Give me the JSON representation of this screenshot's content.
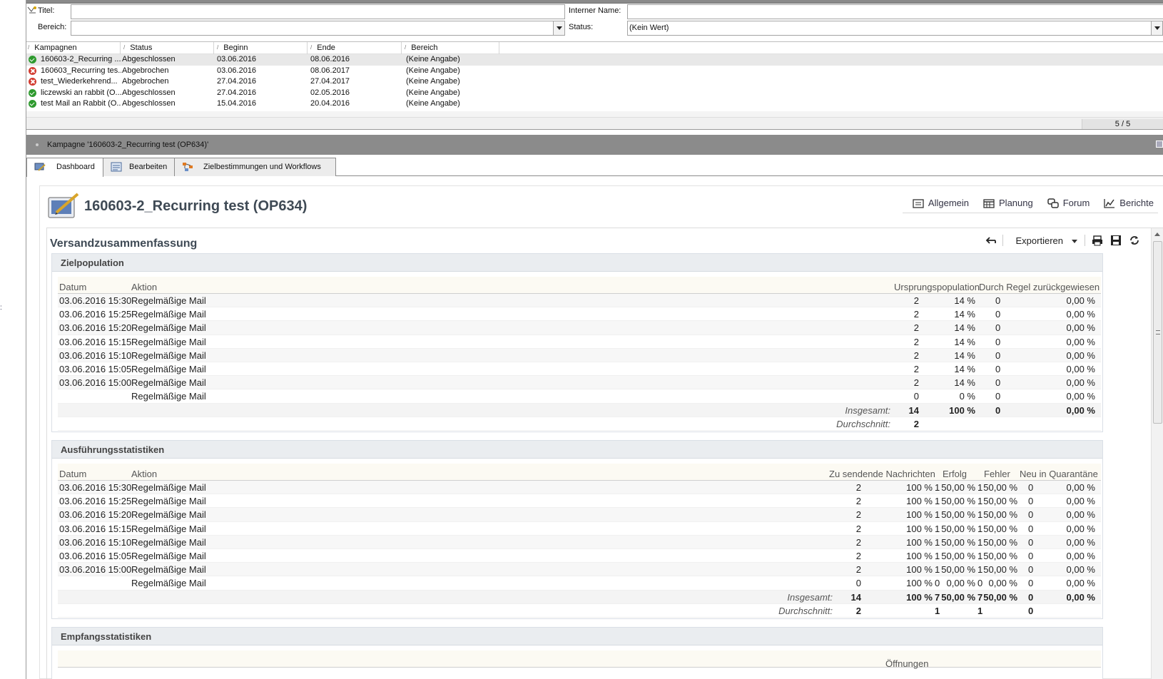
{
  "filter": {
    "title_label": "Titel:",
    "title_value": "",
    "internal_name_label": "Interner Name:",
    "internal_name_value": "",
    "area_label": "Bereich:",
    "area_value": "",
    "status_label": "Status:",
    "status_value": "(Kein Wert)"
  },
  "campaign_list": {
    "columns": [
      "Kampagnen",
      "Status",
      "Beginn",
      "Ende",
      "Bereich"
    ],
    "rows": [
      {
        "name": "160603-2_Recurring ...",
        "status": "Abgeschlossen",
        "begin": "03.06.2016",
        "end": "08.06.2016",
        "area": "(Keine Angabe)",
        "icon": "status-completed-icon"
      },
      {
        "name": "160603_Recurring tes...",
        "status": "Abgebrochen",
        "begin": "03.06.2016",
        "end": "08.06.2017",
        "area": "(Keine Angabe)",
        "icon": "status-cancelled-icon"
      },
      {
        "name": "test_Wiederkehrend...",
        "status": "Abgebrochen",
        "begin": "27.04.2016",
        "end": "27.04.2017",
        "area": "(Keine Angabe)",
        "icon": "status-cancelled-icon"
      },
      {
        "name": "liczewski an rabbit (O...",
        "status": "Abgeschlossen",
        "begin": "27.04.2016",
        "end": "02.05.2016",
        "area": "(Keine Angabe)",
        "icon": "status-completed-icon"
      },
      {
        "name": "test Mail an Rabbit (O...",
        "status": "Abgeschlossen",
        "begin": "15.04.2016",
        "end": "20.04.2016",
        "area": "(Keine Angabe)",
        "icon": "status-completed-icon"
      }
    ],
    "pager": "5 / 5"
  },
  "campaign_bar": {
    "title": "Kampagne '160603-2_Recurring test (OP634)'"
  },
  "tabs": [
    {
      "label": "Dashboard",
      "icon": "dashboard-icon",
      "active": true
    },
    {
      "label": "Bearbeiten",
      "icon": "edit-form-icon",
      "active": false
    },
    {
      "label": "Zielbestimmungen und Workflows",
      "icon": "workflow-icon",
      "active": false
    }
  ],
  "dashboard": {
    "title": "160603-2_Recurring test (OP634)",
    "nav": [
      {
        "label": "Allgemein",
        "icon": "general-icon"
      },
      {
        "label": "Planung",
        "icon": "calendar-icon"
      },
      {
        "label": "Forum",
        "icon": "forum-icon"
      },
      {
        "label": "Berichte",
        "icon": "chart-icon"
      }
    ]
  },
  "summary": {
    "title": "Versandzusammenfassung",
    "export_label": "Exportieren",
    "target": {
      "title": "Zielpopulation",
      "headers": [
        "Datum",
        "Aktion",
        "Ursprungspopulation",
        "Durch Regel zurückgewiesen"
      ],
      "rows": [
        [
          "03.06.2016 15:30",
          "Regelmäßige Mail",
          "2",
          "14 %",
          "0",
          "0,00 %"
        ],
        [
          "03.06.2016 15:25",
          "Regelmäßige Mail",
          "2",
          "14 %",
          "0",
          "0,00 %"
        ],
        [
          "03.06.2016 15:20",
          "Regelmäßige Mail",
          "2",
          "14 %",
          "0",
          "0,00 %"
        ],
        [
          "03.06.2016 15:15",
          "Regelmäßige Mail",
          "2",
          "14 %",
          "0",
          "0,00 %"
        ],
        [
          "03.06.2016 15:10",
          "Regelmäßige Mail",
          "2",
          "14 %",
          "0",
          "0,00 %"
        ],
        [
          "03.06.2016 15:05",
          "Regelmäßige Mail",
          "2",
          "14 %",
          "0",
          "0,00 %"
        ],
        [
          "03.06.2016 15:00",
          "Regelmäßige Mail",
          "2",
          "14 %",
          "0",
          "0,00 %"
        ],
        [
          "",
          "Regelmäßige Mail",
          "0",
          "0 %",
          "0",
          "0,00 %"
        ]
      ],
      "total": {
        "label": "Insgesamt:",
        "values": [
          "14",
          "100 %",
          "0",
          "0,00 %"
        ]
      },
      "average": {
        "label": "Durchschnitt:",
        "values": [
          "2"
        ]
      }
    },
    "execution": {
      "title": "Ausführungsstatistiken",
      "headers": [
        "Datum",
        "Aktion",
        "Zu sendende Nachrichten",
        "Erfolg",
        "Fehler",
        "Neu in Quarantäne"
      ],
      "rows": [
        [
          "03.06.2016 15:30",
          "Regelmäßige Mail",
          "2",
          "100 %",
          "1",
          "50,00 %",
          "1",
          "50,00 %",
          "0",
          "0,00 %"
        ],
        [
          "03.06.2016 15:25",
          "Regelmäßige Mail",
          "2",
          "100 %",
          "1",
          "50,00 %",
          "1",
          "50,00 %",
          "0",
          "0,00 %"
        ],
        [
          "03.06.2016 15:20",
          "Regelmäßige Mail",
          "2",
          "100 %",
          "1",
          "50,00 %",
          "1",
          "50,00 %",
          "0",
          "0,00 %"
        ],
        [
          "03.06.2016 15:15",
          "Regelmäßige Mail",
          "2",
          "100 %",
          "1",
          "50,00 %",
          "1",
          "50,00 %",
          "0",
          "0,00 %"
        ],
        [
          "03.06.2016 15:10",
          "Regelmäßige Mail",
          "2",
          "100 %",
          "1",
          "50,00 %",
          "1",
          "50,00 %",
          "0",
          "0,00 %"
        ],
        [
          "03.06.2016 15:05",
          "Regelmäßige Mail",
          "2",
          "100 %",
          "1",
          "50,00 %",
          "1",
          "50,00 %",
          "0",
          "0,00 %"
        ],
        [
          "03.06.2016 15:00",
          "Regelmäßige Mail",
          "2",
          "100 %",
          "1",
          "50,00 %",
          "1",
          "50,00 %",
          "0",
          "0,00 %"
        ],
        [
          "",
          "Regelmäßige Mail",
          "0",
          "100 %",
          "0",
          "0,00 %",
          "0",
          "0,00 %",
          "0",
          "0,00 %"
        ]
      ],
      "total": {
        "label": "Insgesamt:",
        "values": [
          "14",
          "100 %",
          "7",
          "50,00 %",
          "7",
          "50,00 %",
          "0",
          "0,00 %"
        ]
      },
      "average": {
        "label": "Durchschnitt:",
        "values": [
          "2",
          "1",
          "1",
          "0"
        ]
      }
    },
    "reception": {
      "title": "Empfangsstatistiken",
      "partial_header": "Öffnungen"
    }
  },
  "colors": {
    "panel_header": "#8b8b8b",
    "section_header": "#eaedf0",
    "title_text": "#3f4a55",
    "ok_green": "#2e9a2e",
    "error_red": "#d23b30"
  }
}
